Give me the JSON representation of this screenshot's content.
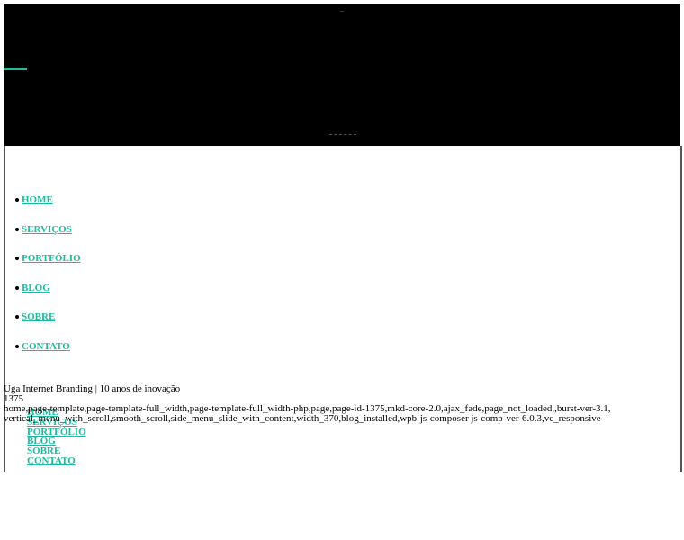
{
  "header": {
    "accent_color": "#1abc9c",
    "background": "#000000"
  },
  "main_menu": {
    "items": [
      {
        "label": "HOME"
      },
      {
        "label": "SERVIÇOS"
      },
      {
        "label": "PORTFÓLIO"
      },
      {
        "label": "BLOG"
      },
      {
        "label": "SOBRE"
      },
      {
        "label": "CONTATO"
      }
    ]
  },
  "info": {
    "site_title": "Uga Internet Branding | 10 anos de inovação",
    "page_id": "1375",
    "body_classes_line1": "home,page-template,page-template-full_width,page-template-full_width-php,page,page-id-1375,mkd-core-2.0,ajax_fade,page_not_loaded,,burst-ver-3.1,",
    "body_classes_line2": "vertical_menu_with_scroll,smooth_scroll,side_menu_slide_with_content,width_370,blog_installed,wpb-js-composer js-comp-ver-6.0.3,vc_responsive"
  },
  "footer_menu": {
    "items": [
      {
        "label": "HOME"
      },
      {
        "label": "SERVIÇOS"
      },
      {
        "label": "PORTFÓLIO"
      },
      {
        "label": "BLOG"
      },
      {
        "label": "SOBRE"
      },
      {
        "label": "CONTATO"
      }
    ]
  }
}
